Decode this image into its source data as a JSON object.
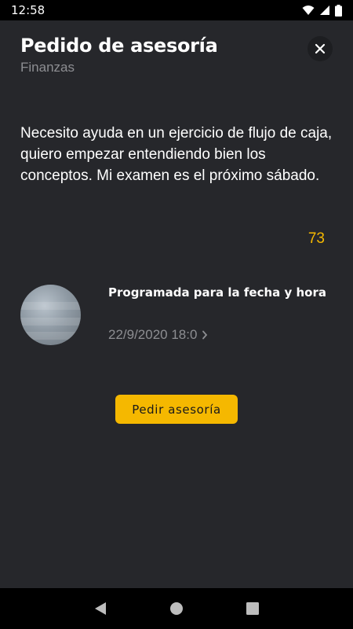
{
  "status_bar": {
    "time": "12:58",
    "icons": [
      "wifi-icon",
      "signal-icon",
      "battery-icon"
    ]
  },
  "header": {
    "title": "Pedido de asesoría",
    "subtitle": "Finanzas",
    "close_icon": "close-icon"
  },
  "request": {
    "description": "Necesito ayuda en un ejercicio de flujo de caja, quiero empezar entendiendo bien los conceptos. Mi examen es el próximo sábado.",
    "char_counter": "73"
  },
  "schedule": {
    "label": "Programada para la fecha y hora",
    "datetime": "22/9/2020 18:0"
  },
  "actions": {
    "submit_label": "Pedir asesoría"
  },
  "navigation": {
    "icons": [
      "back-icon",
      "home-icon",
      "recents-icon"
    ]
  },
  "colors": {
    "background": "#26272b",
    "accent": "#f5b800",
    "muted_text": "#8d8e92"
  }
}
